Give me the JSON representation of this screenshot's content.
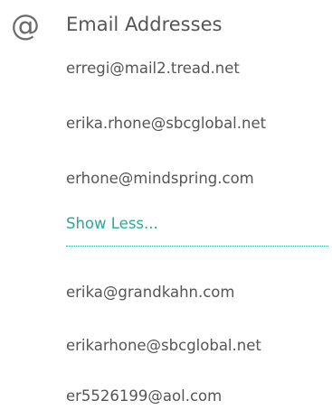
{
  "section": {
    "icon": "at-icon",
    "icon_glyph": "@",
    "title": "Email Addresses"
  },
  "emails_top": [
    "erregi@mail2.tread.net",
    "erika.rhone@sbcglobal.net",
    "erhone@mindspring.com"
  ],
  "toggle": {
    "label": "Show Less..."
  },
  "emails_bottom": [
    "erika@grandkahn.com",
    "erikarhone@sbcglobal.net",
    "er5526199@aol.com"
  ],
  "colors": {
    "text": "#555555",
    "accent": "#2aa898",
    "icon": "#6b6b6b"
  }
}
